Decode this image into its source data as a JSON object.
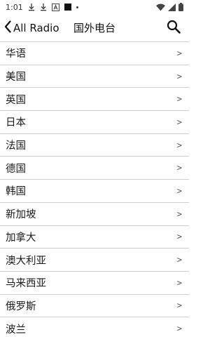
{
  "status_bar": {
    "time": "1:01",
    "icons": [
      "download-icon",
      "download-icon",
      "font-icon",
      "black-square-icon",
      "dot-icon",
      "wifi-icon",
      "signal-icon",
      "battery-icon"
    ]
  },
  "app_bar": {
    "back_label": "All Radio",
    "title": "国外电台",
    "search_icon": "search-icon"
  },
  "list": {
    "chevron": ">",
    "items": [
      {
        "label": "华语"
      },
      {
        "label": "美国"
      },
      {
        "label": "英国"
      },
      {
        "label": "日本"
      },
      {
        "label": "法国"
      },
      {
        "label": "德国"
      },
      {
        "label": "韩国"
      },
      {
        "label": "新加坡"
      },
      {
        "label": "加拿大"
      },
      {
        "label": "澳大利亚"
      },
      {
        "label": "马来西亚"
      },
      {
        "label": "俄罗斯"
      },
      {
        "label": "波兰"
      }
    ]
  }
}
